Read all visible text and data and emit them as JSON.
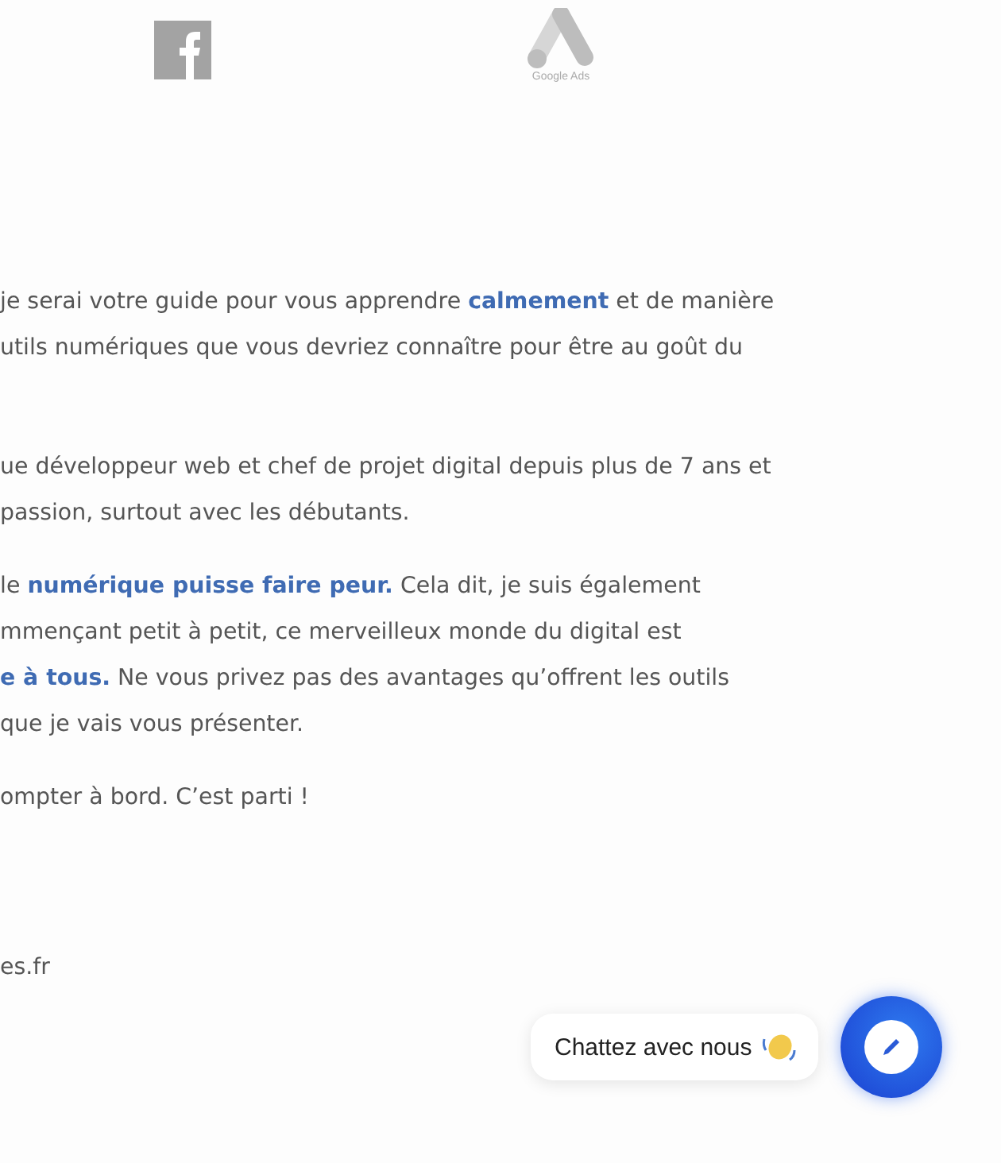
{
  "logos": [
    {
      "kind": "facebook"
    },
    {
      "kind": "google_ads",
      "caption": "Google Ads"
    }
  ],
  "paragraphs": [
    [
      "je serai votre guide pour vous apprendre **calmement** et de manière",
      "utils numériques que vous devriez connaître pour être au goût du"
    ],
    [
      "ue développeur web et chef de projet digital depuis plus de 7 ans et",
      "passion, surtout avec les débutants."
    ],
    [
      "le **numérique puisse faire peur.** Cela dit,  je suis également",
      "mmençant petit à petit, ce merveilleux monde du digital est",
      "**e à tous.** Ne vous privez pas des avantages qu’offrent les outils",
      "que je vais vous présenter."
    ],
    [
      "ompter à bord. C’est parti !"
    ]
  ],
  "site": "es.fr",
  "chat": {
    "label": "Chattez avec nous"
  }
}
